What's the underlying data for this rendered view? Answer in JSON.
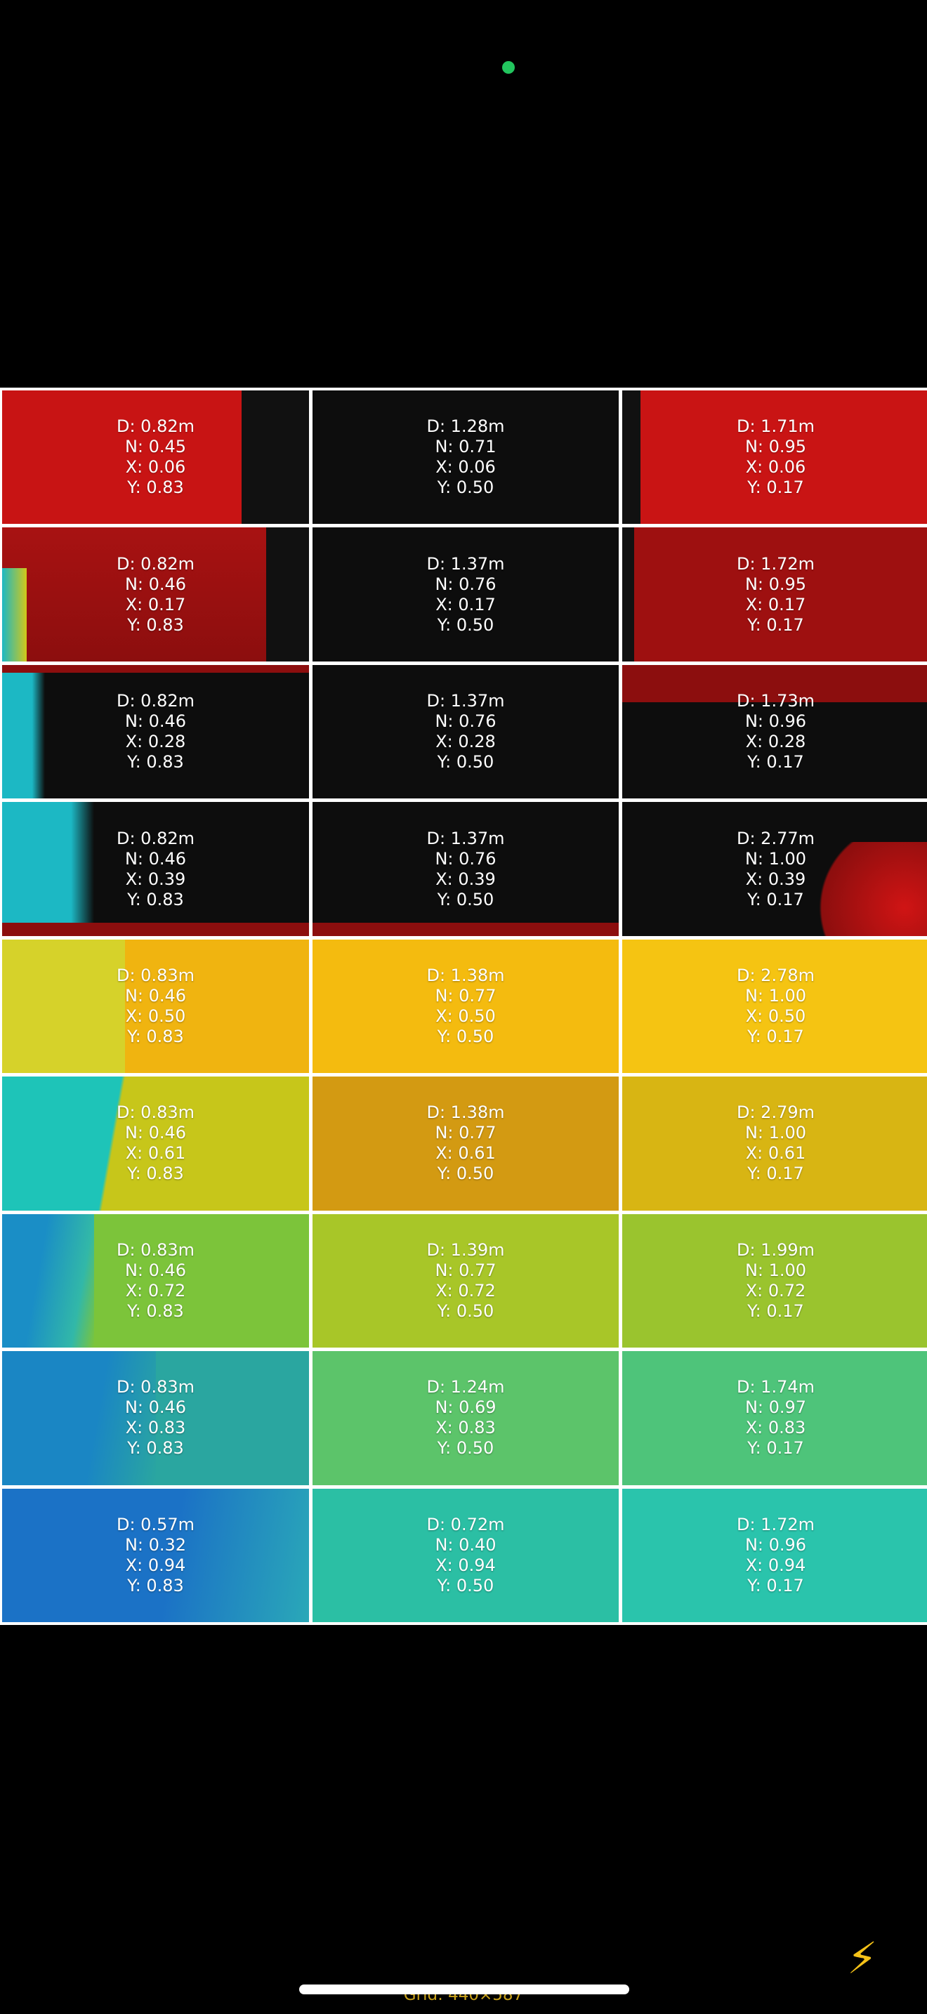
{
  "colors": {
    "background": "#000000",
    "status_dot": "#22c55e",
    "grid_lines": "#ffffff",
    "flash": "#f5c218",
    "grid_label": "#c8a11a"
  },
  "flash_icon": "⚡",
  "grid_label": "Grid: 440×587",
  "cells": [
    {
      "d": "D: 0.82m",
      "n": "N: 0.45",
      "x": "X: 0.06",
      "y": "Y: 0.83",
      "bg": "#c51414"
    },
    {
      "d": "D: 1.28m",
      "n": "N: 0.71",
      "x": "X: 0.06",
      "y": "Y: 0.50",
      "bg": "#0d0d0d"
    },
    {
      "d": "D: 1.71m",
      "n": "N: 0.95",
      "x": "X: 0.06",
      "y": "Y: 0.17",
      "bg": "#c91414"
    },
    {
      "d": "D: 0.82m",
      "n": "N: 0.46",
      "x": "X: 0.17",
      "y": "Y: 0.83",
      "bg": "#9b1010"
    },
    {
      "d": "D: 1.37m",
      "n": "N: 0.76",
      "x": "X: 0.17",
      "y": "Y: 0.50",
      "bg": "#0d0d0d"
    },
    {
      "d": "D: 1.72m",
      "n": "N: 0.95",
      "x": "X: 0.17",
      "y": "Y: 0.17",
      "bg": "#9e1010"
    },
    {
      "d": "D: 0.82m",
      "n": "N: 0.46",
      "x": "X: 0.28",
      "y": "Y: 0.83",
      "bg": "#0d0d0d"
    },
    {
      "d": "D: 1.37m",
      "n": "N: 0.76",
      "x": "X: 0.28",
      "y": "Y: 0.50",
      "bg": "#0d0d0d"
    },
    {
      "d": "D: 1.73m",
      "n": "N: 0.96",
      "x": "X: 0.28",
      "y": "Y: 0.17",
      "bg": "#0d0d0d"
    },
    {
      "d": "D: 0.82m",
      "n": "N: 0.46",
      "x": "X: 0.39",
      "y": "Y: 0.83",
      "bg": "#0d0d0d"
    },
    {
      "d": "D: 1.37m",
      "n": "N: 0.76",
      "x": "X: 0.39",
      "y": "Y: 0.50",
      "bg": "#0d0d0d"
    },
    {
      "d": "D: 2.77m",
      "n": "N: 1.00",
      "x": "X: 0.39",
      "y": "Y: 0.17",
      "bg": "#0d0d0d"
    },
    {
      "d": "D: 0.83m",
      "n": "N: 0.46",
      "x": "X: 0.50",
      "y": "Y: 0.83",
      "bg": "#f0b410"
    },
    {
      "d": "D: 1.38m",
      "n": "N: 0.77",
      "x": "X: 0.50",
      "y": "Y: 0.50",
      "bg": "#f4bb0f"
    },
    {
      "d": "D: 2.78m",
      "n": "N: 1.00",
      "x": "X: 0.50",
      "y": "Y: 0.17",
      "bg": "#f5c412"
    },
    {
      "d": "D: 0.83m",
      "n": "N: 0.46",
      "x": "X: 0.61",
      "y": "Y: 0.83",
      "bg": "#c7c61a"
    },
    {
      "d": "D: 1.38m",
      "n": "N: 0.77",
      "x": "X: 0.61",
      "y": "Y: 0.50",
      "bg": "#d39a12"
    },
    {
      "d": "D: 2.79m",
      "n": "N: 1.00",
      "x": "X: 0.61",
      "y": "Y: 0.17",
      "bg": "#d8b513"
    },
    {
      "d": "D: 0.83m",
      "n": "N: 0.46",
      "x": "X: 0.72",
      "y": "Y: 0.83",
      "bg": "#7cc43a"
    },
    {
      "d": "D: 1.39m",
      "n": "N: 0.77",
      "x": "X: 0.72",
      "y": "Y: 0.50",
      "bg": "#a8c628"
    },
    {
      "d": "D: 1.99m",
      "n": "N: 1.00",
      "x": "X: 0.72",
      "y": "Y: 0.17",
      "bg": "#9ac42e"
    },
    {
      "d": "D: 0.83m",
      "n": "N: 0.46",
      "x": "X: 0.83",
      "y": "Y: 0.83",
      "bg": "#2aa6a0"
    },
    {
      "d": "D: 1.24m",
      "n": "N: 0.69",
      "x": "X: 0.83",
      "y": "Y: 0.50",
      "bg": "#5cc46a"
    },
    {
      "d": "D: 1.74m",
      "n": "N: 0.97",
      "x": "X: 0.83",
      "y": "Y: 0.17",
      "bg": "#4ec47a"
    },
    {
      "d": "D: 0.57m",
      "n": "N: 0.32",
      "x": "X: 0.94",
      "y": "Y: 0.83",
      "bg": "#1b8cc2"
    },
    {
      "d": "D: 0.72m",
      "n": "N: 0.40",
      "x": "X: 0.94",
      "y": "Y: 0.50",
      "bg": "#2bbfa4"
    },
    {
      "d": "D: 1.72m",
      "n": "N: 0.96",
      "x": "X: 0.94",
      "y": "Y: 0.17",
      "bg": "#2ac4ac"
    }
  ]
}
